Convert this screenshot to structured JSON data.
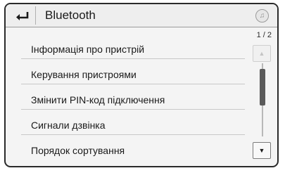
{
  "header": {
    "title": "Bluetooth",
    "back_icon": "back-arrow-icon",
    "music_icon": "music-note-icon",
    "music_glyph": "♫"
  },
  "menu": {
    "items": [
      {
        "label": "Інформація про пристрій"
      },
      {
        "label": "Керування пристроями"
      },
      {
        "label": "Змінити PIN-код підключення"
      },
      {
        "label": "Сигнали дзвінка"
      },
      {
        "label": "Порядок сортування"
      }
    ]
  },
  "scroll": {
    "page": "1 / 2",
    "up_glyph": "▲",
    "down_glyph": "▼",
    "thumb_position": "top"
  },
  "colors": {
    "frame": "#2a2a2a",
    "background": "#f4f4f4",
    "text": "#1a1a1a",
    "divider": "#c8c8c8"
  }
}
